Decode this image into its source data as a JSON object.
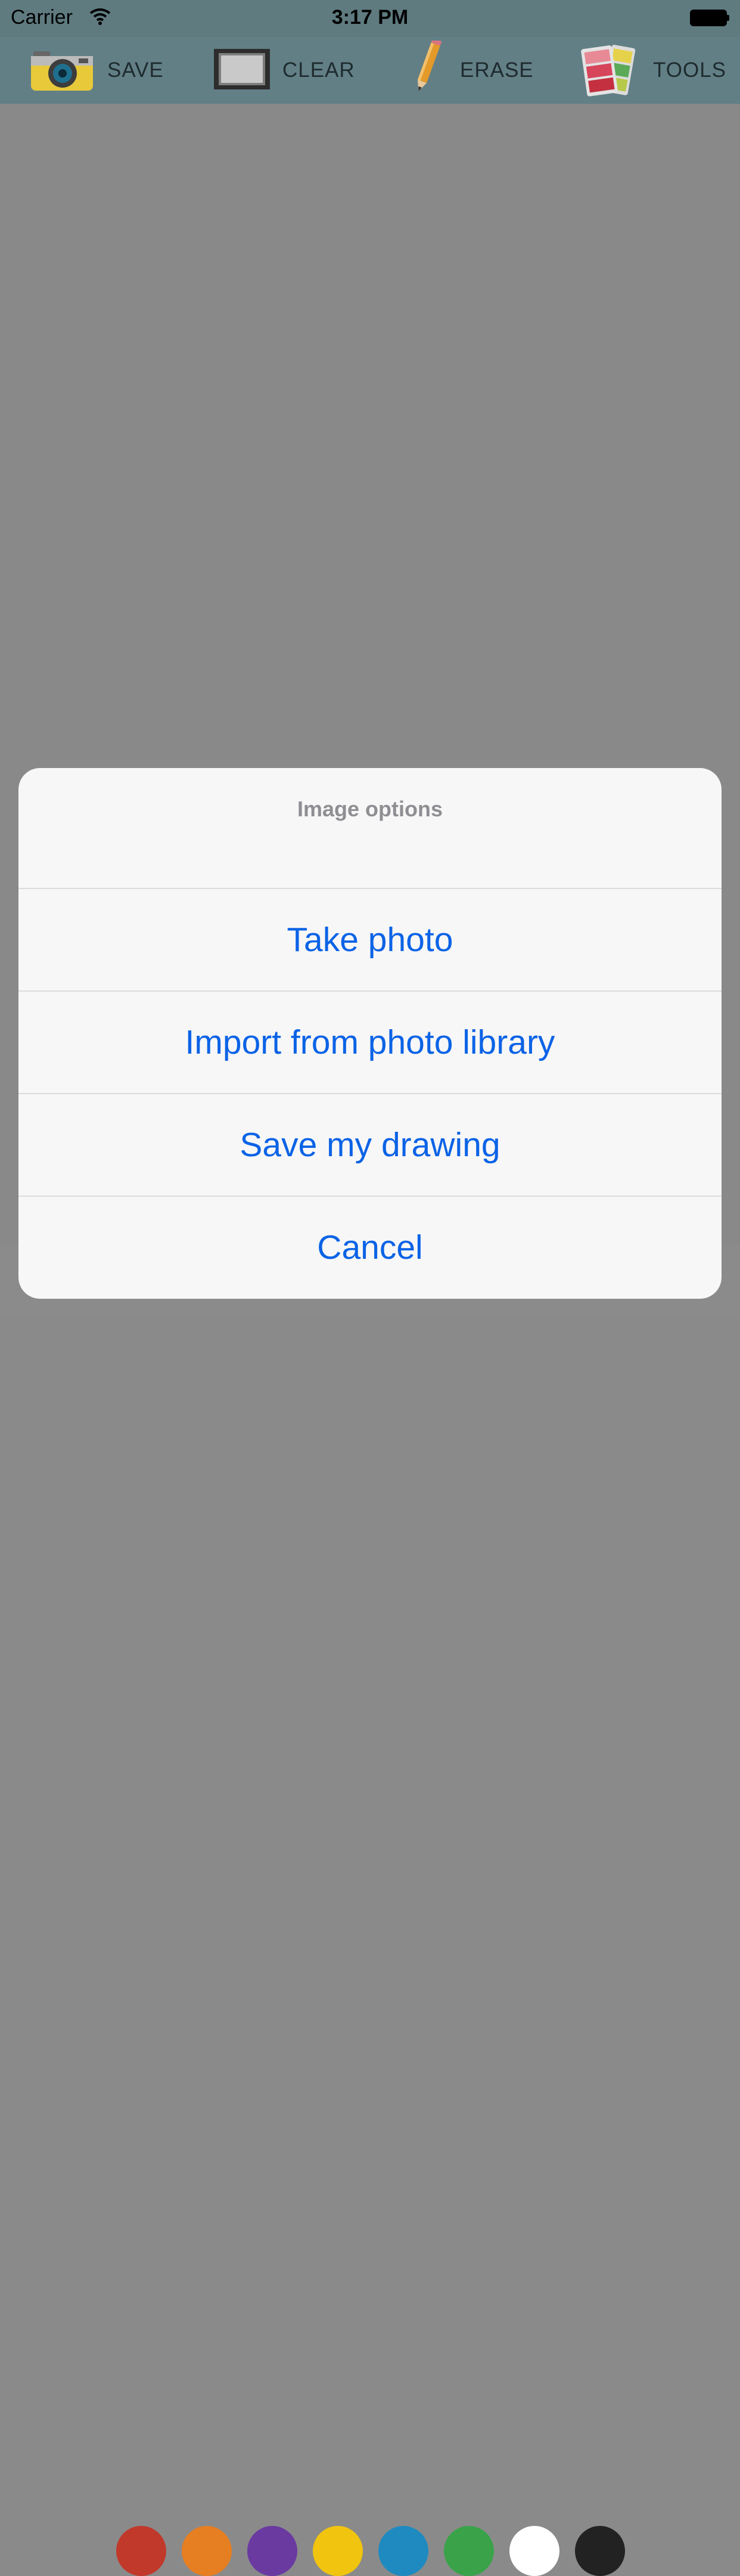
{
  "status_bar": {
    "carrier": "Carrier",
    "time": "3:17 PM"
  },
  "toolbar": {
    "save_label": "SAVE",
    "clear_label": "CLEAR",
    "erase_label": "ERASE",
    "tools_label": "TOOLS"
  },
  "action_sheet": {
    "title": "Image options",
    "actions": [
      "Take photo",
      "Import from photo library",
      "Save my drawing"
    ],
    "cancel_label": "Cancel"
  },
  "palette_colors": [
    "#c0392b",
    "#e67e22",
    "#6a3aa1",
    "#f1c40f",
    "#1f8ac0",
    "#3aa34a",
    "#ffffff",
    "#222222"
  ],
  "colors": {
    "toolbar": "#627f86",
    "accent": "#0b63e6",
    "dim": "#898989"
  }
}
